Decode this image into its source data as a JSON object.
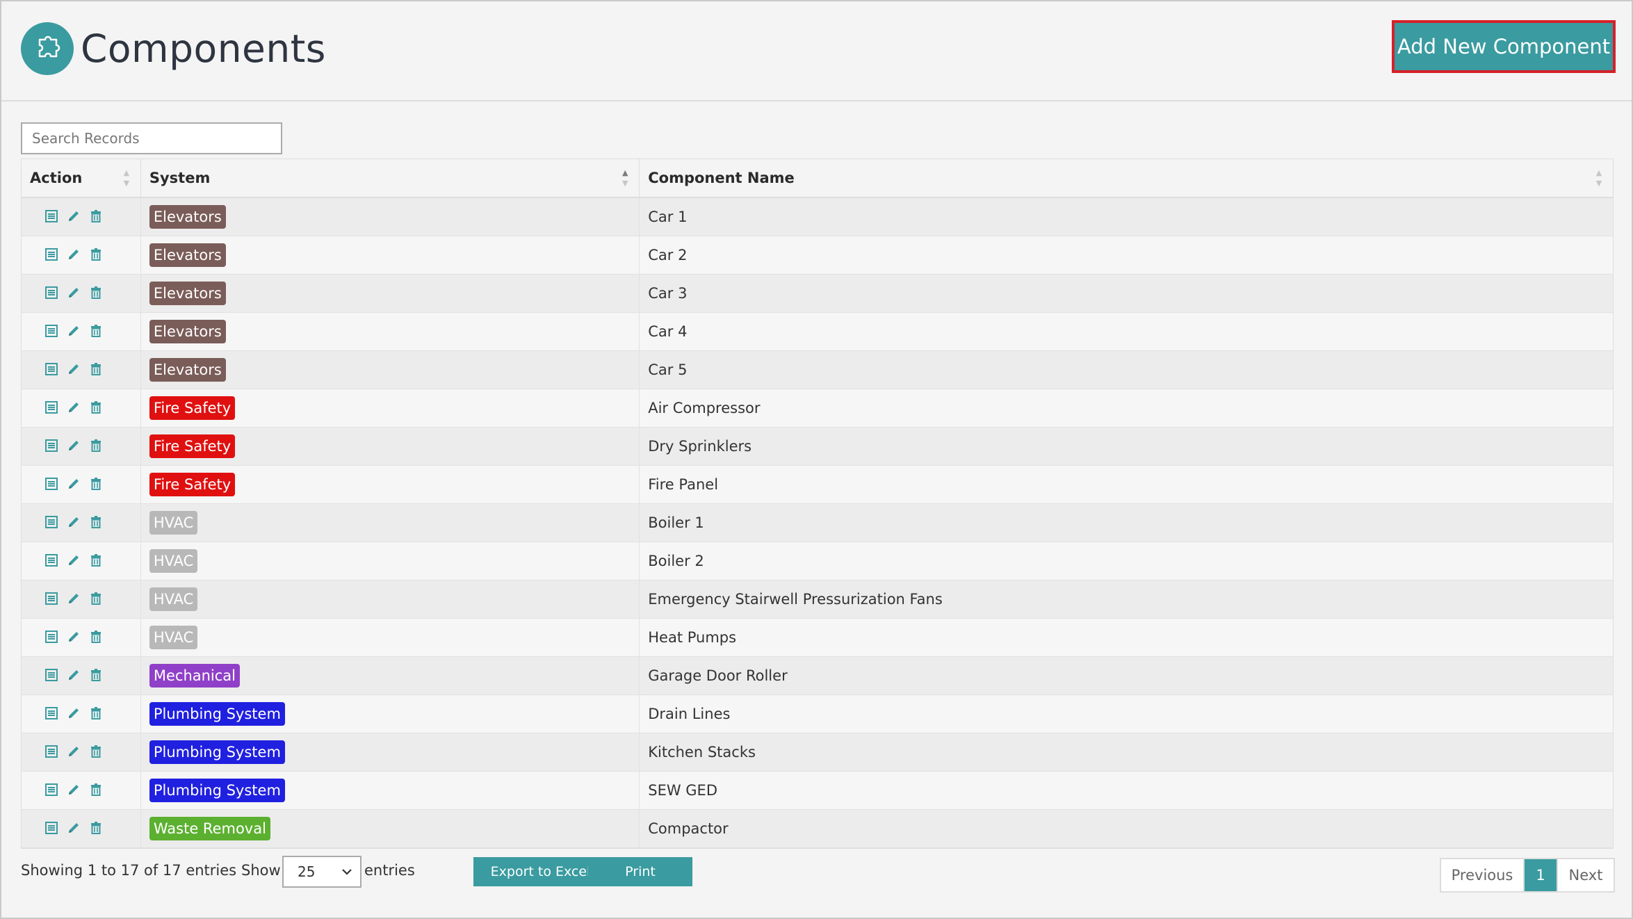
{
  "header": {
    "title": "Components",
    "add_button_label": "Add New Component",
    "logo_icon": "puzzle-icon"
  },
  "search": {
    "placeholder": "Search Records",
    "value": ""
  },
  "table": {
    "columns": [
      "Action",
      "System",
      "Component Name"
    ],
    "sorted_column": "System",
    "sort_direction": "ascending",
    "action_icons": [
      "view-icon",
      "edit-icon",
      "delete-icon"
    ],
    "rows": [
      {
        "system": "Elevators",
        "system_color": "#7a5c58",
        "name": "Car 1"
      },
      {
        "system": "Elevators",
        "system_color": "#7a5c58",
        "name": "Car 2"
      },
      {
        "system": "Elevators",
        "system_color": "#7a5c58",
        "name": "Car 3"
      },
      {
        "system": "Elevators",
        "system_color": "#7a5c58",
        "name": "Car 4"
      },
      {
        "system": "Elevators",
        "system_color": "#7a5c58",
        "name": "Car 5"
      },
      {
        "system": "Fire Safety",
        "system_color": "#e01010",
        "name": "Air Compressor"
      },
      {
        "system": "Fire Safety",
        "system_color": "#e01010",
        "name": "Dry Sprinklers"
      },
      {
        "system": "Fire Safety",
        "system_color": "#e01010",
        "name": "Fire Panel"
      },
      {
        "system": "HVAC",
        "system_color": "#b8b8b8",
        "name": "Boiler 1"
      },
      {
        "system": "HVAC",
        "system_color": "#b8b8b8",
        "name": "Boiler 2"
      },
      {
        "system": "HVAC",
        "system_color": "#b8b8b8",
        "name": "Emergency Stairwell Pressurization Fans"
      },
      {
        "system": "HVAC",
        "system_color": "#b8b8b8",
        "name": "Heat Pumps"
      },
      {
        "system": "Mechanical",
        "system_color": "#9040c8",
        "name": "Garage Door Roller"
      },
      {
        "system": "Plumbing System",
        "system_color": "#2020e0",
        "name": "Drain Lines"
      },
      {
        "system": "Plumbing System",
        "system_color": "#2020e0",
        "name": "Kitchen Stacks"
      },
      {
        "system": "Plumbing System",
        "system_color": "#2020e0",
        "name": "SEW GED"
      },
      {
        "system": "Waste Removal",
        "system_color": "#5cb030",
        "name": "Compactor"
      }
    ]
  },
  "footer": {
    "info": "Showing 1 to 17 of 17 entries",
    "show_label": "Show",
    "page_size": "25",
    "entries_label": "entries",
    "export_label": "Export to Excel",
    "print_label": "Print",
    "prev_label": "Previous",
    "current_page": "1",
    "next_label": "Next"
  },
  "colors": {
    "accent": "#3a9ba0",
    "highlight_border": "#d6212a"
  }
}
